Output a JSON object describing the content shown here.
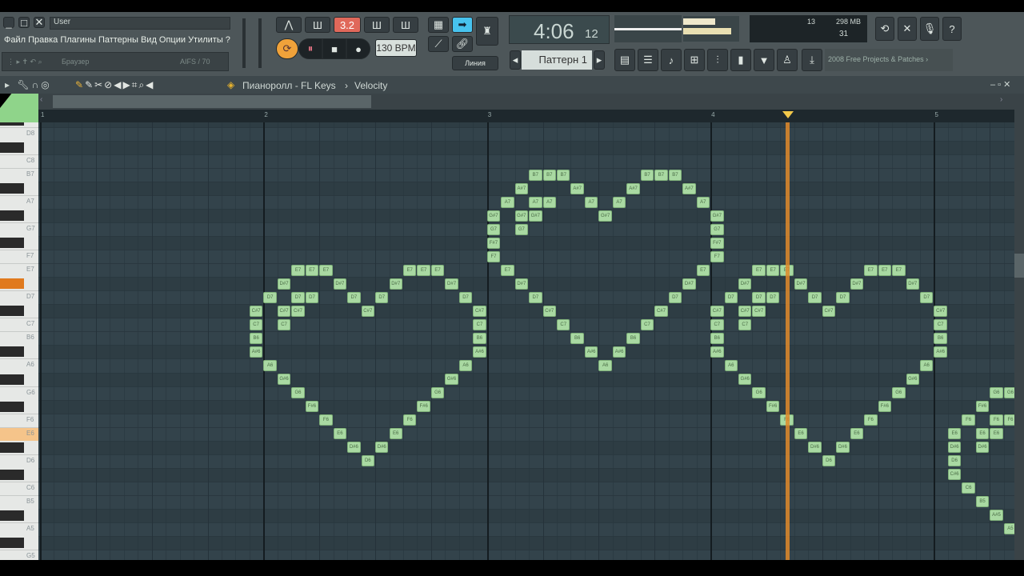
{
  "window": {
    "user_field": "User",
    "menu": "Файл Правка Плагины Паттерны Вид Опции Утилиты ?",
    "browser_label": "Браузер",
    "browser_value": "AIFS / 70"
  },
  "transport": {
    "pattern_mode": "3.2",
    "tempo": "130 BPM",
    "time": "4:06",
    "time_sub": "12",
    "snap": "Линия",
    "pattern": "Паттерн 1"
  },
  "cpu": {
    "value": "13",
    "memory": "298 MB",
    "polyphony": "31"
  },
  "news": {
    "date": "2008",
    "text": "Free Projects & Patches"
  },
  "piano_roll": {
    "breadcrumb_1": "Пианоролл - FL Keys",
    "breadcrumb_2": "Velocity",
    "separator": "›"
  },
  "colors": {
    "note": "#a9d9a2",
    "playhead": "#e08a2a",
    "grid": "#33434b"
  },
  "ruler": {
    "bars": [
      "1",
      "2",
      "3",
      "4",
      "5"
    ]
  },
  "playhead": {
    "bar": 4,
    "step": 6
  },
  "piano": {
    "highlighted_keys": [
      "D#7",
      "E6"
    ],
    "top_key": "D8"
  },
  "chart_data": {
    "type": "piano-roll",
    "steps_per_bar": 16,
    "heart_shape": [
      [
        0,
        3
      ],
      [
        0,
        4
      ],
      [
        0,
        5
      ],
      [
        0,
        11
      ],
      [
        0,
        12
      ],
      [
        0,
        13
      ],
      [
        1,
        2
      ],
      [
        1,
        6
      ],
      [
        1,
        10
      ],
      [
        1,
        14
      ],
      [
        2,
        1
      ],
      [
        2,
        3
      ],
      [
        2,
        4
      ],
      [
        2,
        7
      ],
      [
        2,
        9
      ],
      [
        2,
        15
      ],
      [
        3,
        0
      ],
      [
        3,
        2
      ],
      [
        3,
        3
      ],
      [
        3,
        8
      ],
      [
        3,
        16
      ],
      [
        4,
        0
      ],
      [
        4,
        2
      ],
      [
        4,
        16
      ],
      [
        5,
        0
      ],
      [
        5,
        16
      ],
      [
        6,
        0
      ],
      [
        6,
        16
      ],
      [
        7,
        1
      ],
      [
        7,
        15
      ],
      [
        8,
        2
      ],
      [
        8,
        14
      ],
      [
        9,
        3
      ],
      [
        9,
        13
      ],
      [
        10,
        4
      ],
      [
        10,
        12
      ],
      [
        11,
        5
      ],
      [
        11,
        11
      ],
      [
        12,
        6
      ],
      [
        12,
        10
      ],
      [
        13,
        7
      ],
      [
        13,
        9
      ],
      [
        14,
        8
      ]
    ],
    "hearts": [
      {
        "start_step": 15,
        "top_pitch": "E7"
      },
      {
        "start_step": 32,
        "top_pitch": "B7"
      },
      {
        "start_step": 48,
        "top_pitch": "E7"
      },
      {
        "start_step": 65,
        "top_pitch": "G6"
      }
    ]
  }
}
